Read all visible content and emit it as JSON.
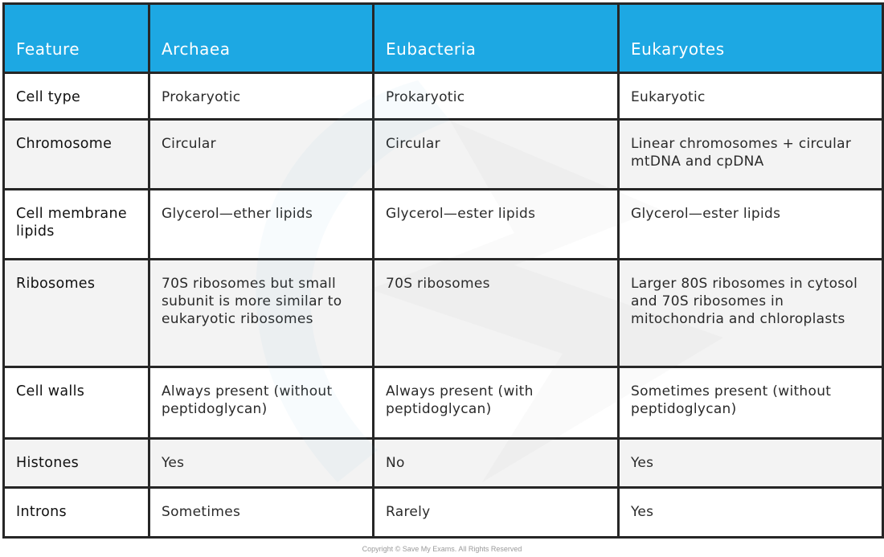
{
  "table": {
    "headers": [
      "Feature",
      "Archaea",
      "Eubacteria",
      "Eukaryotes"
    ],
    "rows": [
      {
        "feature": "Cell type",
        "archaea": "Prokaryotic",
        "eubacteria": "Prokaryotic",
        "eukaryotes": "Eukaryotic"
      },
      {
        "feature": "Chromosome",
        "archaea": "Circular",
        "eubacteria": "Circular",
        "eukaryotes": "Linear chromosomes + circular mtDNA and cpDNA"
      },
      {
        "feature": "Cell membrane lipids",
        "archaea": "Glycerol—ether lipids",
        "eubacteria": "Glycerol—ester lipids",
        "eukaryotes": "Glycerol—ester lipids"
      },
      {
        "feature": "Ribosomes",
        "archaea": "70S ribosomes but small subunit is more similar to eukaryotic ribosomes",
        "eubacteria": "70S ribosomes",
        "eukaryotes": "Larger 80S ribosomes in cytosol and 70S ribosomes in mitochondria and chloroplasts"
      },
      {
        "feature": "Cell walls",
        "archaea": "Always present (without  peptidoglycan)",
        "eubacteria": "Always present (with  peptidoglycan)",
        "eukaryotes": "Sometimes present (without peptidoglycan)"
      },
      {
        "feature": "Histones",
        "archaea": "Yes",
        "eubacteria": "No",
        "eukaryotes": "Yes"
      },
      {
        "feature": "Introns",
        "archaea": "Sometimes",
        "eubacteria": "Rarely",
        "eukaryotes": "Yes"
      }
    ]
  },
  "colors": {
    "header_bg": "#1da8e3",
    "header_text": "#ffffff",
    "border": "#262626",
    "row_alt_bg": "#f3f3f3"
  },
  "footer": {
    "copyright": "Copyright © Save My Exams. All Rights Reserved"
  }
}
